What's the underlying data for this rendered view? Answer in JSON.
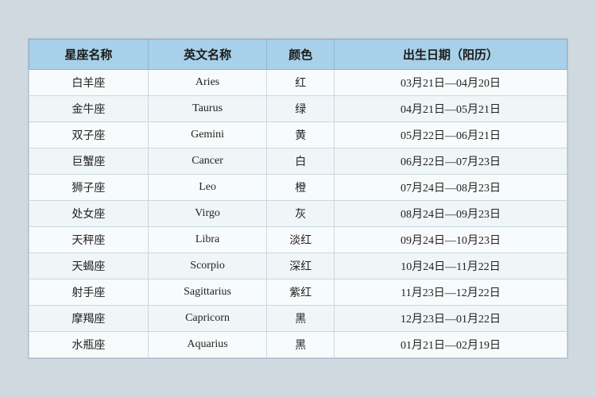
{
  "table": {
    "headers": [
      "星座名称",
      "英文名称",
      "颜色",
      "出生日期（阳历）"
    ],
    "rows": [
      {
        "cn": "白羊座",
        "en": "Aries",
        "color": "红",
        "dates": "03月21日—04月20日"
      },
      {
        "cn": "金牛座",
        "en": "Taurus",
        "color": "绿",
        "dates": "04月21日—05月21日"
      },
      {
        "cn": "双子座",
        "en": "Gemini",
        "color": "黄",
        "dates": "05月22日—06月21日"
      },
      {
        "cn": "巨蟹座",
        "en": "Cancer",
        "color": "白",
        "dates": "06月22日—07月23日"
      },
      {
        "cn": "狮子座",
        "en": "Leo",
        "color": "橙",
        "dates": "07月24日—08月23日"
      },
      {
        "cn": "处女座",
        "en": "Virgo",
        "color": "灰",
        "dates": "08月24日—09月23日"
      },
      {
        "cn": "天秤座",
        "en": "Libra",
        "color": "淡红",
        "dates": "09月24日—10月23日"
      },
      {
        "cn": "天蝎座",
        "en": "Scorpio",
        "color": "深红",
        "dates": "10月24日—11月22日"
      },
      {
        "cn": "射手座",
        "en": "Sagittarius",
        "color": "紫红",
        "dates": "11月23日—12月22日"
      },
      {
        "cn": "摩羯座",
        "en": "Capricorn",
        "color": "黑",
        "dates": "12月23日—01月22日"
      },
      {
        "cn": "水瓶座",
        "en": "Aquarius",
        "color": "黑",
        "dates": "01月21日—02月19日"
      }
    ]
  }
}
